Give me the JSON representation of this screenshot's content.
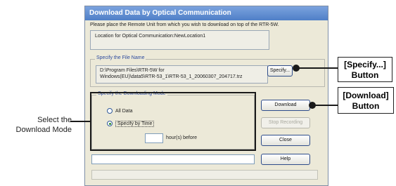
{
  "dialog": {
    "title": "Download Data by Optical Communication",
    "instruction": "Please place the Remote Unit from which you wish to download on top of the RTR-5W.",
    "location_text": "Location for Optical Communication:NewLocation1",
    "file_group_label": "Specify the File Name",
    "file_path_line1": "D:\\Program Files\\RTR-5W for",
    "file_path_line2": "Windows(EU)\\data5\\RTR-53_1\\RTR-53_1_20060307_204717.trz",
    "specify_button": "Specify...",
    "mode_group_label": "Specify the Downloading Mode",
    "radio_all": "All Data",
    "radio_time": "Specify by Time",
    "hours_value": "",
    "hours_suffix": "hour(s) before",
    "download_button": "Download",
    "stop_button": "Stop Recording",
    "close_button": "Close",
    "help_button": "Help",
    "bottom_input_value": ""
  },
  "annotations": {
    "specify_callout_line1": "[Specify...]",
    "specify_callout_line2": "Button",
    "download_callout_line1": "[Download]",
    "download_callout_line2": "Button",
    "select_mode_line1": "Select the",
    "select_mode_line2": "Download Mode"
  }
}
